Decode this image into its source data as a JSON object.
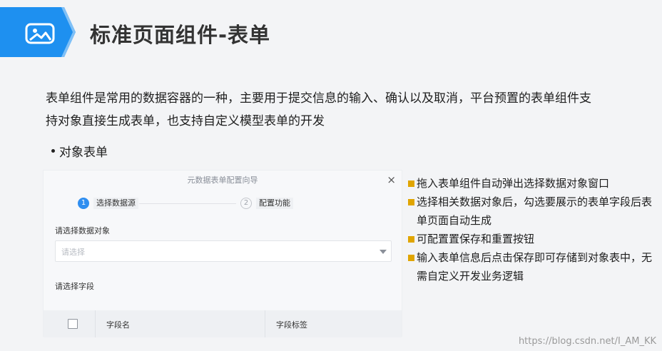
{
  "header": {
    "icon": "image-icon",
    "title": "标准页面组件-表单",
    "accent_color": "#1e90f0"
  },
  "intro": {
    "line1": "表单组件是常用的数据容器的一种，主要用于提交信息的输入、确认以及取消，平台预置的表单组件支",
    "line2": "持对象直接生成表单，也支持自定义模型表单的开发"
  },
  "bullet": "对象表单",
  "dialog": {
    "title": "元数据表单配置向导",
    "close": "×",
    "steps": [
      {
        "num": "1",
        "label": "选择数据源"
      },
      {
        "num": "2",
        "label": "配置功能"
      }
    ],
    "object_label": "请选择数据对象",
    "object_placeholder": "请选择",
    "field_label": "请选择字段",
    "table_headers": [
      "字段名",
      "字段标签"
    ],
    "step_active_color": "#2f8ef0"
  },
  "notes": [
    "拖入表单组件自动弹出选择数据对象窗口",
    "选择相关数据对象后，勾选要展示的表单字段后表单页面自动生成",
    "可配置置保存和重置按钮",
    "输入表单信息后点击保存即可存储到对象表中，无需自定义开发业务逻辑"
  ],
  "note_marker_color": "#e0a500",
  "watermark": "https://blog.csdn.net/I_AM_KK"
}
